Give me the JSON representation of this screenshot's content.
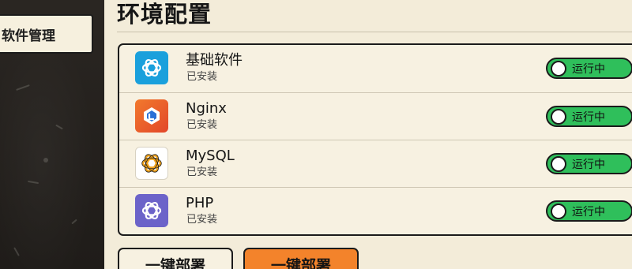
{
  "sidebar": {
    "items": [
      {
        "label": "软件管理",
        "active": true
      }
    ]
  },
  "main": {
    "title": "环境配置",
    "apps": [
      {
        "name": "基础软件",
        "status": "已安装",
        "badge": "运行中",
        "icon": "openai-logo-icon",
        "icon_bg": "#1aa0dc"
      },
      {
        "name": "Nginx",
        "status": "已安装",
        "badge": "运行中",
        "icon": "nginx-app-icon",
        "icon_bg": "#ef5a2b"
      },
      {
        "name": "MySQL",
        "status": "已安装",
        "badge": "运行中",
        "icon": "openai-logo-icon",
        "icon_bg": "#ffffff"
      },
      {
        "name": "PHP",
        "status": "已安装",
        "badge": "运行中",
        "icon": "openai-logo-icon",
        "icon_bg": "#6c63c9"
      }
    ],
    "buttons": {
      "deploy_secondary": "一键部署",
      "deploy_primary": "一键部署"
    }
  },
  "colors": {
    "running_green": "#2fbf5b",
    "primary_orange": "#f3832b",
    "panel_cream": "#f3ecd9"
  }
}
